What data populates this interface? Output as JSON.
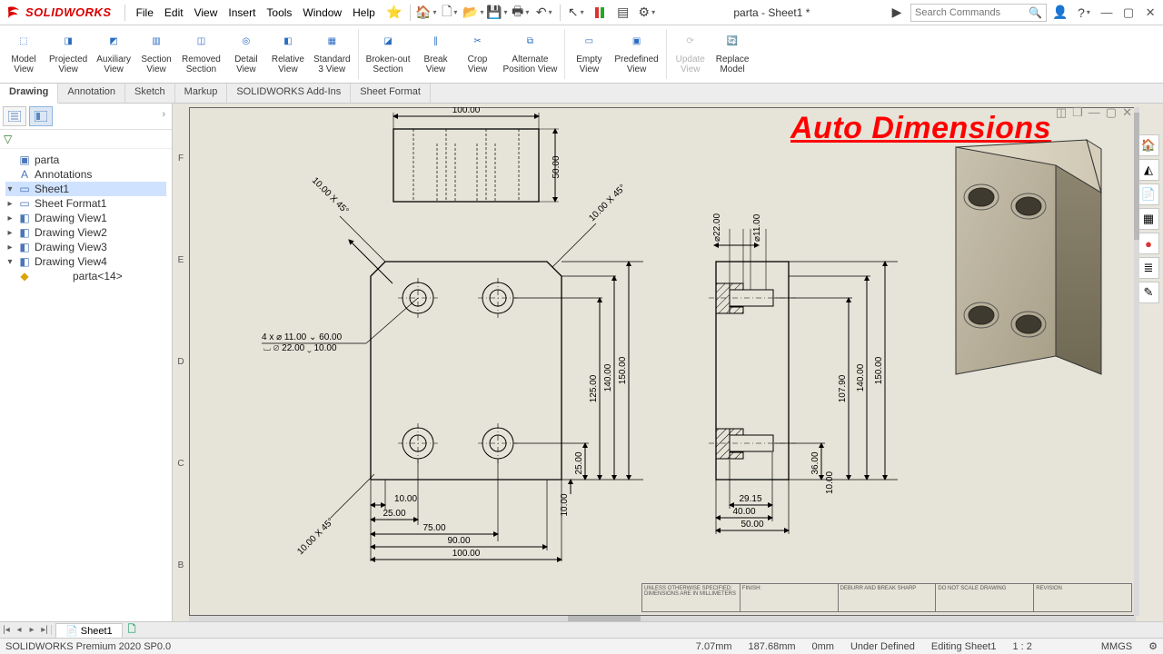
{
  "app": {
    "brand": "SOLIDWORKS",
    "doc_title": "parta - Sheet1 *",
    "edition": "SOLIDWORKS Premium 2020 SP0.0"
  },
  "menus": [
    "File",
    "Edit",
    "View",
    "Insert",
    "Tools",
    "Window",
    "Help"
  ],
  "search": {
    "placeholder": "Search Commands"
  },
  "ribbon": [
    {
      "label": "Model View",
      "name": "model-view"
    },
    {
      "label": "Projected View",
      "name": "projected-view"
    },
    {
      "label": "Auxiliary View",
      "name": "auxiliary-view"
    },
    {
      "label": "Section View",
      "name": "section-view"
    },
    {
      "label": "Removed Section",
      "name": "removed-section"
    },
    {
      "label": "Detail View",
      "name": "detail-view"
    },
    {
      "label": "Relative View",
      "name": "relative-view"
    },
    {
      "label": "Standard 3 View",
      "name": "standard-3-view"
    },
    {
      "label": "Broken-out Section",
      "name": "broken-out-section"
    },
    {
      "label": "Break View",
      "name": "break-view"
    },
    {
      "label": "Crop View",
      "name": "crop-view"
    },
    {
      "label": "Alternate Position View",
      "name": "alternate-position-view"
    },
    {
      "label": "Empty View",
      "name": "empty-view"
    },
    {
      "label": "Predefined View",
      "name": "predefined-view"
    },
    {
      "label": "Update View",
      "name": "update-view",
      "disabled": true
    },
    {
      "label": "Replace Model",
      "name": "replace-model"
    }
  ],
  "tabs": [
    {
      "label": "Drawing",
      "active": true
    },
    {
      "label": "Annotation"
    },
    {
      "label": "Sketch"
    },
    {
      "label": "Markup"
    },
    {
      "label": "SOLIDWORKS Add-Ins"
    },
    {
      "label": "Sheet Format"
    }
  ],
  "tree": {
    "root": "parta",
    "nodes": [
      {
        "label": "Annotations",
        "icon": "A",
        "depth": 1
      },
      {
        "label": "Sheet1",
        "icon": "▭",
        "depth": 1,
        "hl": true,
        "open": true
      },
      {
        "label": "Sheet Format1",
        "icon": "▭",
        "depth": 2,
        "exp": true
      },
      {
        "label": "Drawing View1",
        "icon": "◧",
        "depth": 2,
        "exp": true
      },
      {
        "label": "Drawing View2",
        "icon": "◧",
        "depth": 2,
        "exp": true
      },
      {
        "label": "Drawing View3",
        "icon": "◧",
        "depth": 2,
        "exp": true
      },
      {
        "label": "Drawing View4",
        "icon": "◧",
        "depth": 2,
        "exp": true,
        "open": true
      },
      {
        "label": "parta<14>",
        "icon": "◆",
        "depth": 2,
        "indent": true
      }
    ]
  },
  "sheet_tab": "Sheet1",
  "big_label": "Auto Dimensions",
  "ruler_marks": [
    "F",
    "E",
    "D",
    "C",
    "B"
  ],
  "title_block": [
    "UNLESS OTHERWISE SPECIFIED:\nDIMENSIONS ARE IN MILLIMETERS",
    "FINISH:",
    "DEBURR AND\nBREAK SHARP",
    "DO NOT SCALE DRAWING",
    "REVISION"
  ],
  "dims": {
    "top_w": "100.00",
    "top_h": "50.00",
    "chamfer_tl": "10.00 X 45°",
    "chamfer_tr": "10.00 X 45°",
    "chamfer_bl": "10.00 X 45°",
    "hole_note_a": "4 x ⌀ 11.00 ⌄ 60.00",
    "hole_note_b": "⌴ ⌀ 22.00 ⌄ 10.00",
    "front_w": "100.00",
    "front_90": "90.00",
    "front_75": "75.00",
    "front_25": "25.00",
    "front_10": "10.00",
    "front_h150": "150.00",
    "front_h140": "140.00",
    "front_h125": "125.00",
    "front_h25": "25.00",
    "front_h10": "10.00",
    "side_d22": "⌀22.00",
    "side_d11": "⌀11.00",
    "side_h150": "150.00",
    "side_h140": "140.00",
    "side_h107": "107.90",
    "side_h36": "36.00",
    "side_h10": "10.00",
    "side_w50": "50.00",
    "side_w40": "40.00",
    "side_w29": "29.15"
  },
  "status": {
    "x": "7.07mm",
    "y": "187.68mm",
    "z": "0mm",
    "state": "Under Defined",
    "context": "Editing Sheet1",
    "scale": "1 : 2",
    "units": "MMGS"
  }
}
